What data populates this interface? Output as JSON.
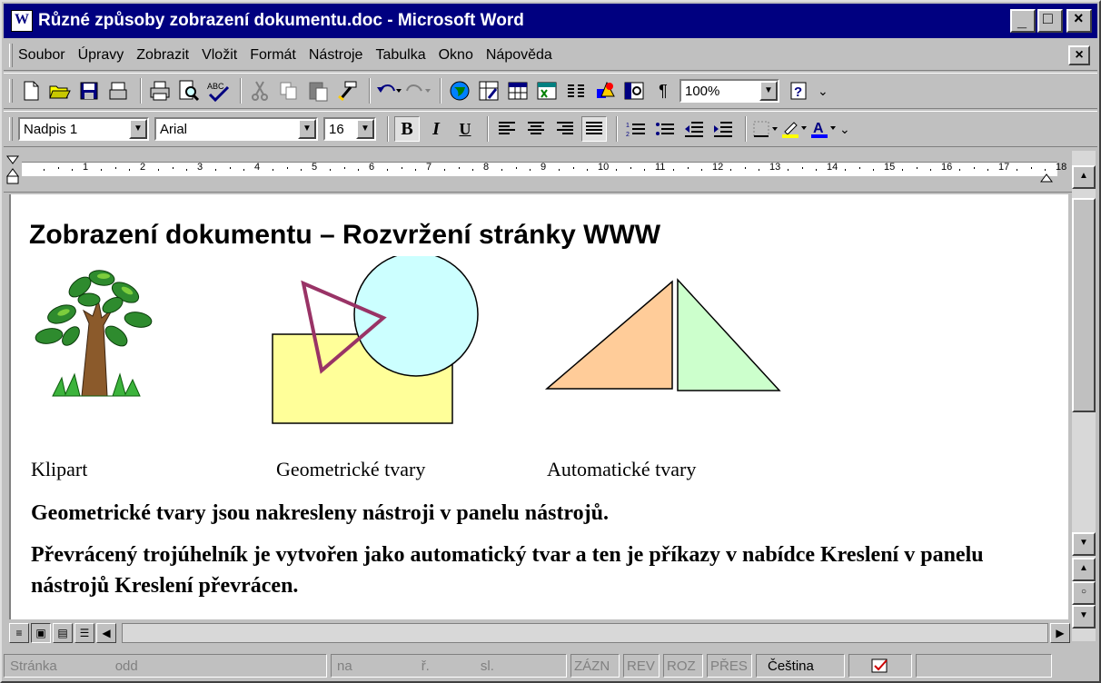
{
  "window": {
    "title": "Různé způsoby zobrazení dokumentu.doc - Microsoft Word",
    "min_glyph": "_",
    "max_glyph": "□",
    "close_glyph": "×"
  },
  "menubar": {
    "items": [
      "Soubor",
      "Úpravy",
      "Zobrazit",
      "Vložit",
      "Formát",
      "Nástroje",
      "Tabulka",
      "Okno",
      "Nápověda"
    ],
    "doc_close_glyph": "×"
  },
  "toolbar_standard": {
    "zoom": "100%",
    "pilcrow": "¶",
    "help_glyph": "?"
  },
  "toolbar_format": {
    "style": "Nadpis 1",
    "font": "Arial",
    "size": "16",
    "bold": "B",
    "italic": "I",
    "underline": "U"
  },
  "ruler": {
    "numbers": [
      "1",
      "2",
      "3",
      "4",
      "5",
      "6",
      "7",
      "8",
      "9",
      "10",
      "11",
      "12",
      "13",
      "14",
      "15",
      "16",
      "17",
      "18"
    ]
  },
  "document": {
    "heading": "Zobrazení dokumentu – Rozvržení stránky WWW",
    "captions": [
      "Klipart",
      "Geometrické tvary",
      "Automatické tvary"
    ],
    "paragraph1": "Geometrické tvary jsou nakresleny nástroji v panelu nástrojů.",
    "paragraph2": "Převrácený trojúhelník je vytvořen jako automatický tvar a ten je příkazy v nabídce Kreslení v panelu nástrojů Kreslení převrácen."
  },
  "statusbar": {
    "page_label": "Stránka",
    "section_label": "odd",
    "position_label": "na",
    "line_label": "ř.",
    "col_label": "sl.",
    "rec": "ZÁZN",
    "rev": "REV",
    "ext": "ROZ",
    "ovr": "PŘES",
    "language": "Čeština"
  },
  "colors": {
    "titlebar": "#000080",
    "rectangle": "#ffff99",
    "circle": "#ccffff",
    "triangle_outline": "#993366",
    "autoshape_left": "#ffcc99",
    "autoshape_right": "#ccffcc"
  }
}
